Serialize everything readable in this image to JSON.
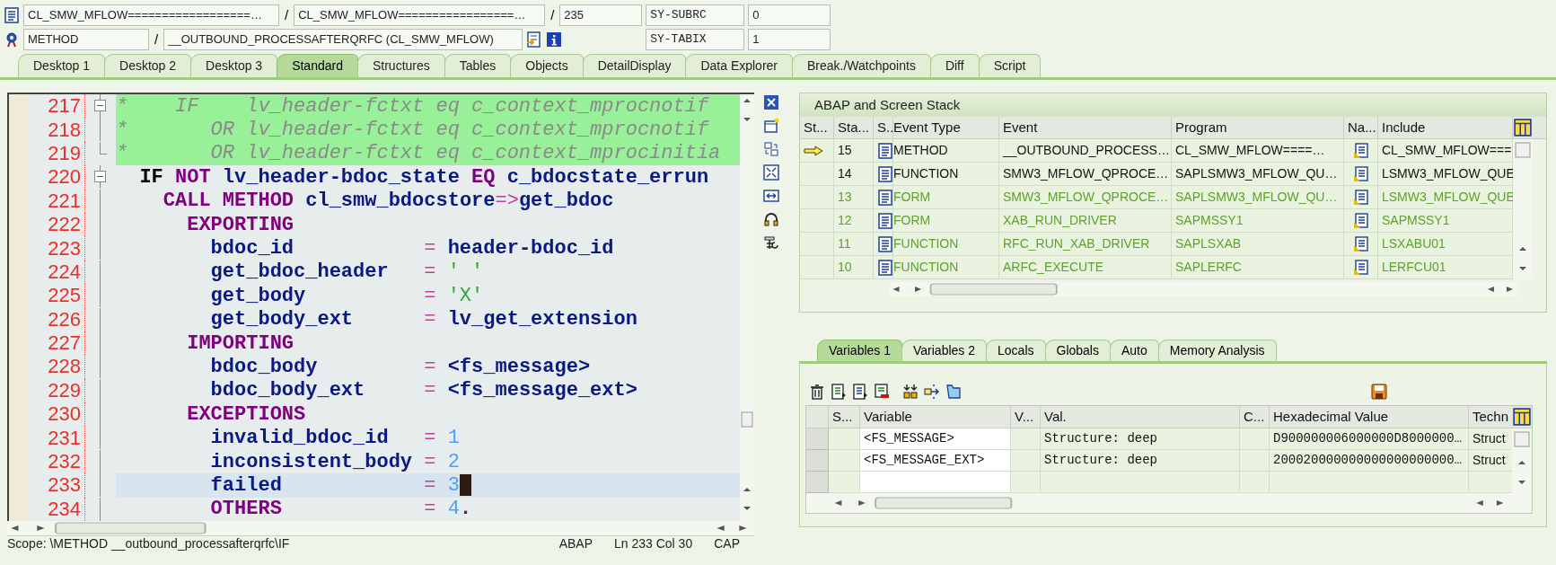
{
  "context": {
    "object": "CL_SMW_MFLOW==================…",
    "separators": [
      "/",
      "/",
      "/"
    ],
    "include": "CL_SMW_MFLOW=================…",
    "line": "235",
    "block_kind": "METHOD",
    "block": "__OUTBOUND_PROCESSAFTERQRFC (CL_SMW_MFLOW)",
    "sysvars": [
      {
        "name": "SY-SUBRC",
        "value": "0"
      },
      {
        "name": "SY-TABIX",
        "value": "1"
      }
    ]
  },
  "tabs": [
    {
      "label": "Desktop 1",
      "selected": false
    },
    {
      "label": "Desktop 2",
      "selected": false
    },
    {
      "label": "Desktop 3",
      "selected": false
    },
    {
      "label": "Standard",
      "selected": true
    },
    {
      "label": "Structures",
      "selected": false
    },
    {
      "label": "Tables",
      "selected": false
    },
    {
      "label": "Objects",
      "selected": false
    },
    {
      "label": "DetailDisplay",
      "selected": false
    },
    {
      "label": "Data Explorer",
      "selected": false
    },
    {
      "label": "Break./Watchpoints",
      "selected": false
    },
    {
      "label": "Diff",
      "selected": false
    },
    {
      "label": "Script",
      "selected": false
    }
  ],
  "editor": {
    "lines": [
      {
        "number": "217",
        "fold_start": true,
        "fold_end": false,
        "marked": true,
        "current": false,
        "tokens": [
          {
            "kind": "comment",
            "text": "*    IF    lv_header-fctxt eq c_context_mprocnotif"
          }
        ]
      },
      {
        "number": "218",
        "fold_start": false,
        "fold_end": false,
        "marked": true,
        "current": false,
        "tokens": [
          {
            "kind": "comment",
            "text": "*       OR lv_header-fctxt eq c_context_mprocnotif"
          }
        ]
      },
      {
        "number": "219",
        "fold_start": false,
        "fold_end": true,
        "marked": true,
        "current": false,
        "tokens": [
          {
            "kind": "comment",
            "text": "*       OR lv_header-fctxt eq c_context_mprocinitia"
          }
        ]
      },
      {
        "number": "220",
        "fold_start": true,
        "fold_end": false,
        "marked": false,
        "current": false,
        "tokens": [
          {
            "kind": "control",
            "text": "  IF"
          },
          {
            "kind": "keyword",
            "text": " NOT"
          },
          {
            "kind": "ident",
            "text": " lv_header-bdoc_state"
          },
          {
            "kind": "keyword",
            "text": " EQ"
          },
          {
            "kind": "ident",
            "text": " c_bdocstate_errun"
          }
        ]
      },
      {
        "number": "221",
        "fold_start": false,
        "fold_end": false,
        "marked": false,
        "current": false,
        "tokens": [
          {
            "kind": "keyword",
            "text": "    CALL METHOD"
          },
          {
            "kind": "ident",
            "text": " cl_smw_bdocstore"
          },
          {
            "kind": "operator",
            "text": "=>"
          },
          {
            "kind": "ident",
            "text": "get_bdoc"
          }
        ]
      },
      {
        "number": "222",
        "fold_start": false,
        "fold_end": false,
        "marked": false,
        "current": false,
        "tokens": [
          {
            "kind": "keyword",
            "text": "      EXPORTING"
          }
        ]
      },
      {
        "number": "223",
        "fold_start": false,
        "fold_end": false,
        "marked": false,
        "current": false,
        "tokens": [
          {
            "kind": "ident",
            "text": "        bdoc_id           "
          },
          {
            "kind": "operator",
            "text": "="
          },
          {
            "kind": "ident",
            "text": " header-bdoc_id"
          }
        ]
      },
      {
        "number": "224",
        "fold_start": false,
        "fold_end": false,
        "marked": false,
        "current": false,
        "tokens": [
          {
            "kind": "ident",
            "text": "        get_bdoc_header   "
          },
          {
            "kind": "operator",
            "text": "="
          },
          {
            "kind": "literal",
            "text": " ' '"
          }
        ]
      },
      {
        "number": "225",
        "fold_start": false,
        "fold_end": false,
        "marked": false,
        "current": false,
        "tokens": [
          {
            "kind": "ident",
            "text": "        get_body          "
          },
          {
            "kind": "operator",
            "text": "="
          },
          {
            "kind": "literal",
            "text": " 'X'"
          }
        ]
      },
      {
        "number": "226",
        "fold_start": false,
        "fold_end": false,
        "marked": false,
        "current": false,
        "tokens": [
          {
            "kind": "ident",
            "text": "        get_body_ext      "
          },
          {
            "kind": "operator",
            "text": "="
          },
          {
            "kind": "ident",
            "text": " lv_get_extension"
          }
        ]
      },
      {
        "number": "227",
        "fold_start": false,
        "fold_end": false,
        "marked": false,
        "current": false,
        "tokens": [
          {
            "kind": "keyword",
            "text": "      IMPORTING"
          }
        ]
      },
      {
        "number": "228",
        "fold_start": false,
        "fold_end": false,
        "marked": false,
        "current": false,
        "tokens": [
          {
            "kind": "ident",
            "text": "        bdoc_body         "
          },
          {
            "kind": "operator",
            "text": "="
          },
          {
            "kind": "ident",
            "text": " <fs_message>"
          }
        ]
      },
      {
        "number": "229",
        "fold_start": false,
        "fold_end": false,
        "marked": false,
        "current": false,
        "tokens": [
          {
            "kind": "ident",
            "text": "        bdoc_body_ext     "
          },
          {
            "kind": "operator",
            "text": "="
          },
          {
            "kind": "ident",
            "text": " <fs_message_ext>"
          }
        ]
      },
      {
        "number": "230",
        "fold_start": false,
        "fold_end": false,
        "marked": false,
        "current": false,
        "tokens": [
          {
            "kind": "keyword",
            "text": "      EXCEPTIONS"
          }
        ]
      },
      {
        "number": "231",
        "fold_start": false,
        "fold_end": false,
        "marked": false,
        "current": false,
        "tokens": [
          {
            "kind": "ident",
            "text": "        invalid_bdoc_id   "
          },
          {
            "kind": "operator",
            "text": "="
          },
          {
            "kind": "number",
            "text": " 1"
          }
        ]
      },
      {
        "number": "232",
        "fold_start": false,
        "fold_end": false,
        "marked": false,
        "current": false,
        "tokens": [
          {
            "kind": "ident",
            "text": "        inconsistent_body "
          },
          {
            "kind": "operator",
            "text": "="
          },
          {
            "kind": "number",
            "text": " 2"
          }
        ]
      },
      {
        "number": "233",
        "fold_start": false,
        "fold_end": false,
        "marked": false,
        "current": true,
        "tokens": [
          {
            "kind": "ident",
            "text": "        failed            "
          },
          {
            "kind": "operator",
            "text": "="
          },
          {
            "kind": "number",
            "text": " 3"
          }
        ]
      },
      {
        "number": "234",
        "fold_start": false,
        "fold_end": false,
        "marked": false,
        "current": false,
        "tokens": [
          {
            "kind": "keyword",
            "text": "        OTHERS            "
          },
          {
            "kind": "operator",
            "text": "="
          },
          {
            "kind": "number",
            "text": " 4"
          },
          {
            "kind": "keyword",
            "text": "."
          }
        ]
      }
    ],
    "status": {
      "scope": "Scope: \\METHOD __outbound_processafterqrfc\\IF",
      "language": "ABAP",
      "position": "Ln 233 Col 30",
      "caps": "CAP"
    }
  },
  "stack": {
    "title": "ABAP and Screen Stack",
    "columns": [
      "St...",
      "Sta...",
      "S..",
      "Event Type",
      "Event",
      "Program",
      "Na...",
      "Include"
    ],
    "rows": [
      {
        "current": true,
        "inactive": false,
        "level": "15",
        "event_type": "METHOD",
        "event": "__OUTBOUND_PROCESS…",
        "program": "CL_SMW_MFLOW====…",
        "include": "CL_SMW_MFLOW==="
      },
      {
        "current": false,
        "inactive": false,
        "level": "14",
        "event_type": "FUNCTION",
        "event": "SMW3_MFLOW_QPROCE…",
        "program": "SAPLSMW3_MFLOW_QU…",
        "include": "LSMW3_MFLOW_QUE"
      },
      {
        "current": false,
        "inactive": true,
        "level": "13",
        "event_type": "FORM",
        "event": "SMW3_MFLOW_QPROCE…",
        "program": "SAPLSMW3_MFLOW_QU…",
        "include": "LSMW3_MFLOW_QUE"
      },
      {
        "current": false,
        "inactive": true,
        "level": "12",
        "event_type": "FORM",
        "event": "XAB_RUN_DRIVER",
        "program": "SAPMSSY1",
        "include": "SAPMSSY1"
      },
      {
        "current": false,
        "inactive": true,
        "level": "11",
        "event_type": "FUNCTION",
        "event": "RFC_RUN_XAB_DRIVER",
        "program": "SAPLSXAB",
        "include": "LSXABU01"
      },
      {
        "current": false,
        "inactive": true,
        "level": "10",
        "event_type": "FUNCTION",
        "event": "ARFC_EXECUTE",
        "program": "SAPLERFC",
        "include": "LERFCU01"
      }
    ]
  },
  "variables": {
    "tabs": [
      {
        "label": "Variables 1",
        "selected": true
      },
      {
        "label": "Variables 2",
        "selected": false
      },
      {
        "label": "Locals",
        "selected": false
      },
      {
        "label": "Globals",
        "selected": false
      },
      {
        "label": "Auto",
        "selected": false
      },
      {
        "label": "Memory Analysis",
        "selected": false
      }
    ],
    "columns": [
      "S...",
      "Variable",
      "V...",
      "Val.",
      "C...",
      "Hexadecimal Value",
      "Techn"
    ],
    "rows": [
      {
        "variable": "<FS_MESSAGE>",
        "value": "Structure: deep",
        "hex": "D900000006000000D8000000…",
        "technical": "Struct"
      },
      {
        "variable": "<FS_MESSAGE_EXT>",
        "value": "Structure: deep",
        "hex": "200020000000000000000000…",
        "technical": "Struct"
      }
    ]
  }
}
